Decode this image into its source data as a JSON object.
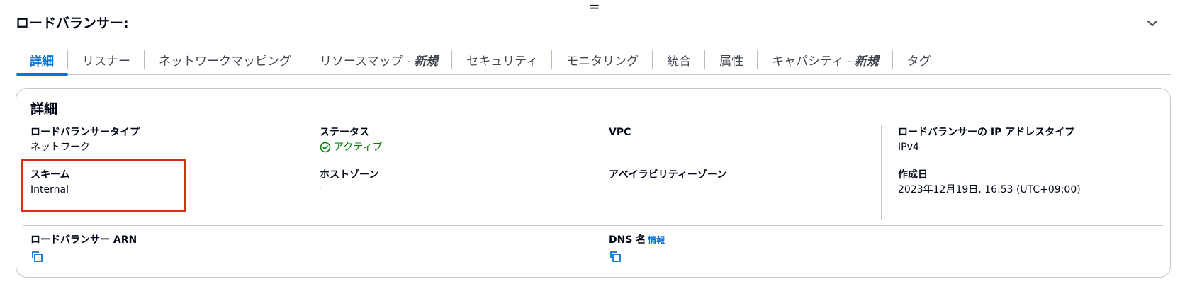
{
  "handle_glyph": "=",
  "header": {
    "title": "ロードバランサー:"
  },
  "tabs": [
    {
      "label": "詳細",
      "new": "",
      "active": true
    },
    {
      "label": "リスナー",
      "new": ""
    },
    {
      "label": "ネットワークマッピング",
      "new": ""
    },
    {
      "label": "リソースマップ - ",
      "new": "新規"
    },
    {
      "label": "セキュリティ",
      "new": ""
    },
    {
      "label": "モニタリング",
      "new": ""
    },
    {
      "label": "統合",
      "new": ""
    },
    {
      "label": "属性",
      "new": ""
    },
    {
      "label": "キャパシティ - ",
      "new": "新規"
    },
    {
      "label": "タグ",
      "new": ""
    }
  ],
  "details": {
    "title": "詳細",
    "lb_type_label": "ロードバランサータイプ",
    "lb_type_value": "ネットワーク",
    "scheme_label": "スキーム",
    "scheme_value": "Internal",
    "status_label": "ステータス",
    "status_value": "アクティブ",
    "hosted_zone_label": "ホストゾーン",
    "vpc_label": "VPC",
    "az_label": "アベイラビリティーゾーン",
    "ip_type_label": "ロードバランサーの IP アドレスタイプ",
    "ip_type_value": "IPv4",
    "created_label": "作成日",
    "created_value": "2023年12月19日, 16:53 (UTC+09:00)",
    "arn_label": "ロードバランサー ARN",
    "dns_label": "DNS 名",
    "dns_info": "情報"
  },
  "colors": {
    "accent": "#0972d3",
    "success": "#037f0c",
    "highlight": "#d13212"
  }
}
